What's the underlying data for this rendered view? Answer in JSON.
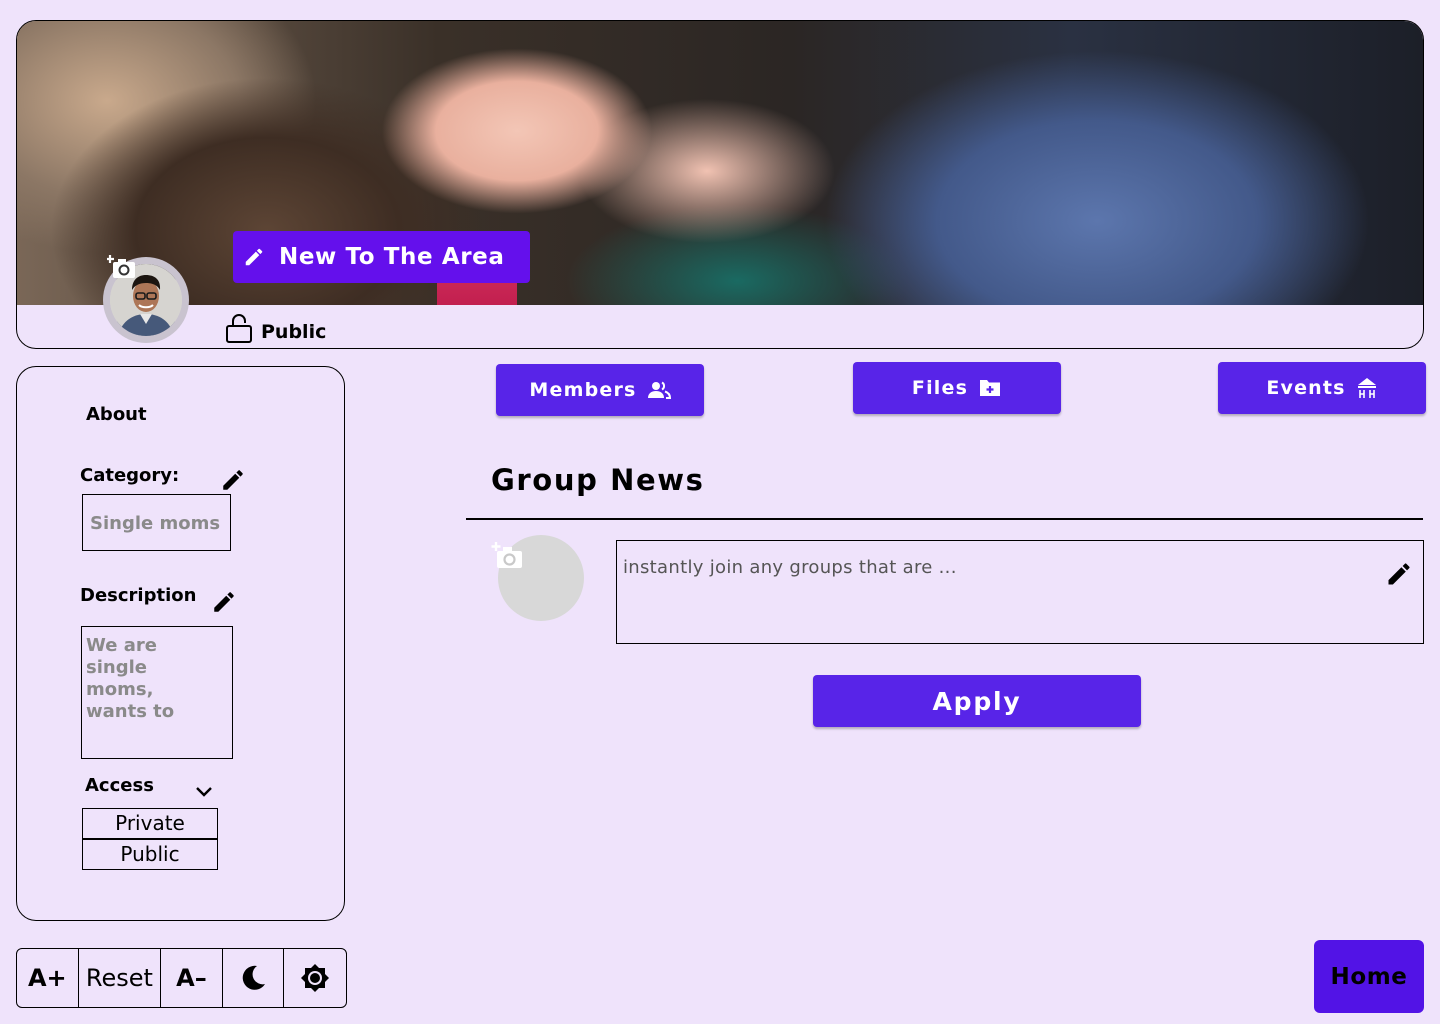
{
  "group": {
    "name": "New To The Area",
    "privacy": "Public"
  },
  "about": {
    "title": "About",
    "category_label": "Category:",
    "category_value": "Single moms",
    "description_label": "Description",
    "description_value": "We are single moms, wants to",
    "access_label": "Access",
    "access_options": [
      "Private",
      "Public"
    ]
  },
  "tabs": {
    "members": "Members",
    "files": "Files",
    "events": "Events"
  },
  "news": {
    "title": "Group News",
    "post_placeholder": "instantly join any groups that are ...",
    "apply": "Apply"
  },
  "toolbar": {
    "increase": "A+",
    "reset": "Reset",
    "decrease": "A–"
  },
  "home": "Home",
  "colors": {
    "background": "#efe3fb",
    "primary": "#5824e8",
    "title_button": "#6410ec"
  }
}
